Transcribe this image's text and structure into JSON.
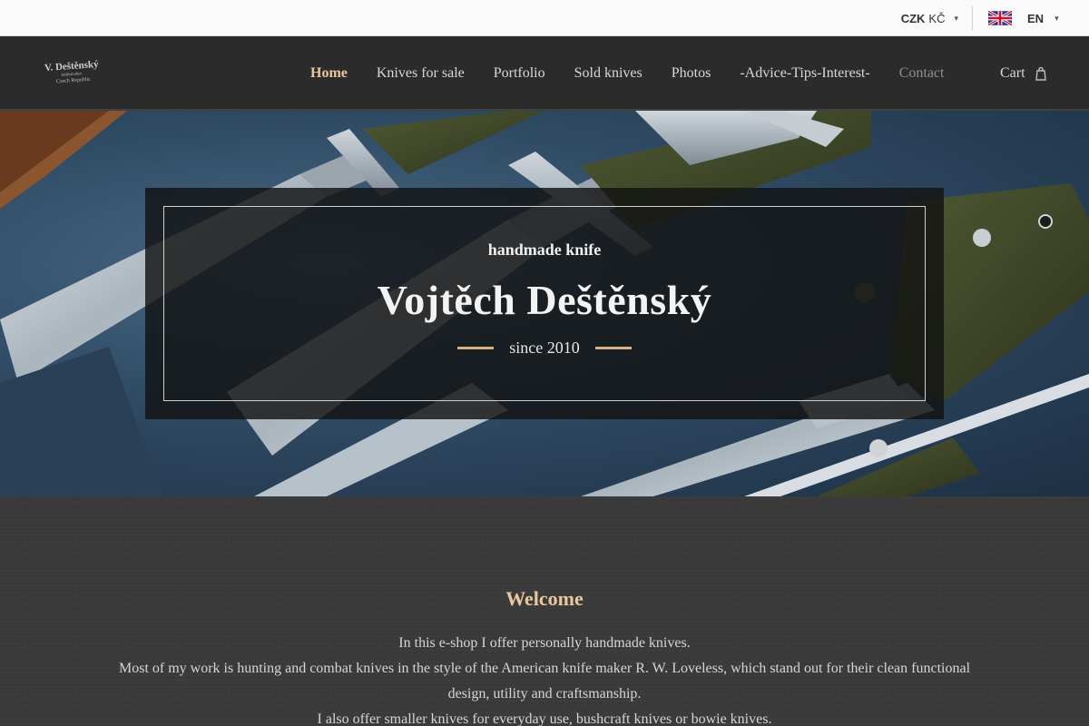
{
  "topbar": {
    "currency_code": "CZK",
    "currency_symbol": "KČ",
    "language": "EN",
    "chevron_glyph": "▾"
  },
  "header": {
    "logo_text": "V. Deštěnský",
    "logo_subtext": "knifemaker",
    "logo_small": "Czech Republic",
    "nav": [
      {
        "label": "Home"
      },
      {
        "label": "Knives for sale"
      },
      {
        "label": "Portfolio"
      },
      {
        "label": "Sold knives"
      },
      {
        "label": "Photos"
      },
      {
        "label": "-Advice-Tips-Interest-"
      },
      {
        "label": "Contact"
      }
    ],
    "cart_label": "Cart"
  },
  "hero": {
    "subtitle": "handmade knife",
    "title": "Vojtěch Deštěnský",
    "since": "since 2010"
  },
  "welcome": {
    "heading": "Welcome",
    "paragraphs": [
      "In this e-shop I offer personally handmade knives.",
      "Most of my work is hunting and combat knives in the style of the American knife maker R. W. Loveless, which stand out for their clean functional design, utility and craftsmanship.",
      "I also offer smaller knives for everyday use, bushcraft knives or bowie knives."
    ]
  },
  "colors": {
    "accent": "#e9c89e",
    "header_bg": "#2b2b2b",
    "topbar_bg": "#fafafa",
    "page_bg": "#3a3a3a"
  },
  "icons": {
    "flag": "uk-flag-icon",
    "cart": "cart-icon",
    "chevron": "chevron-down-icon"
  }
}
